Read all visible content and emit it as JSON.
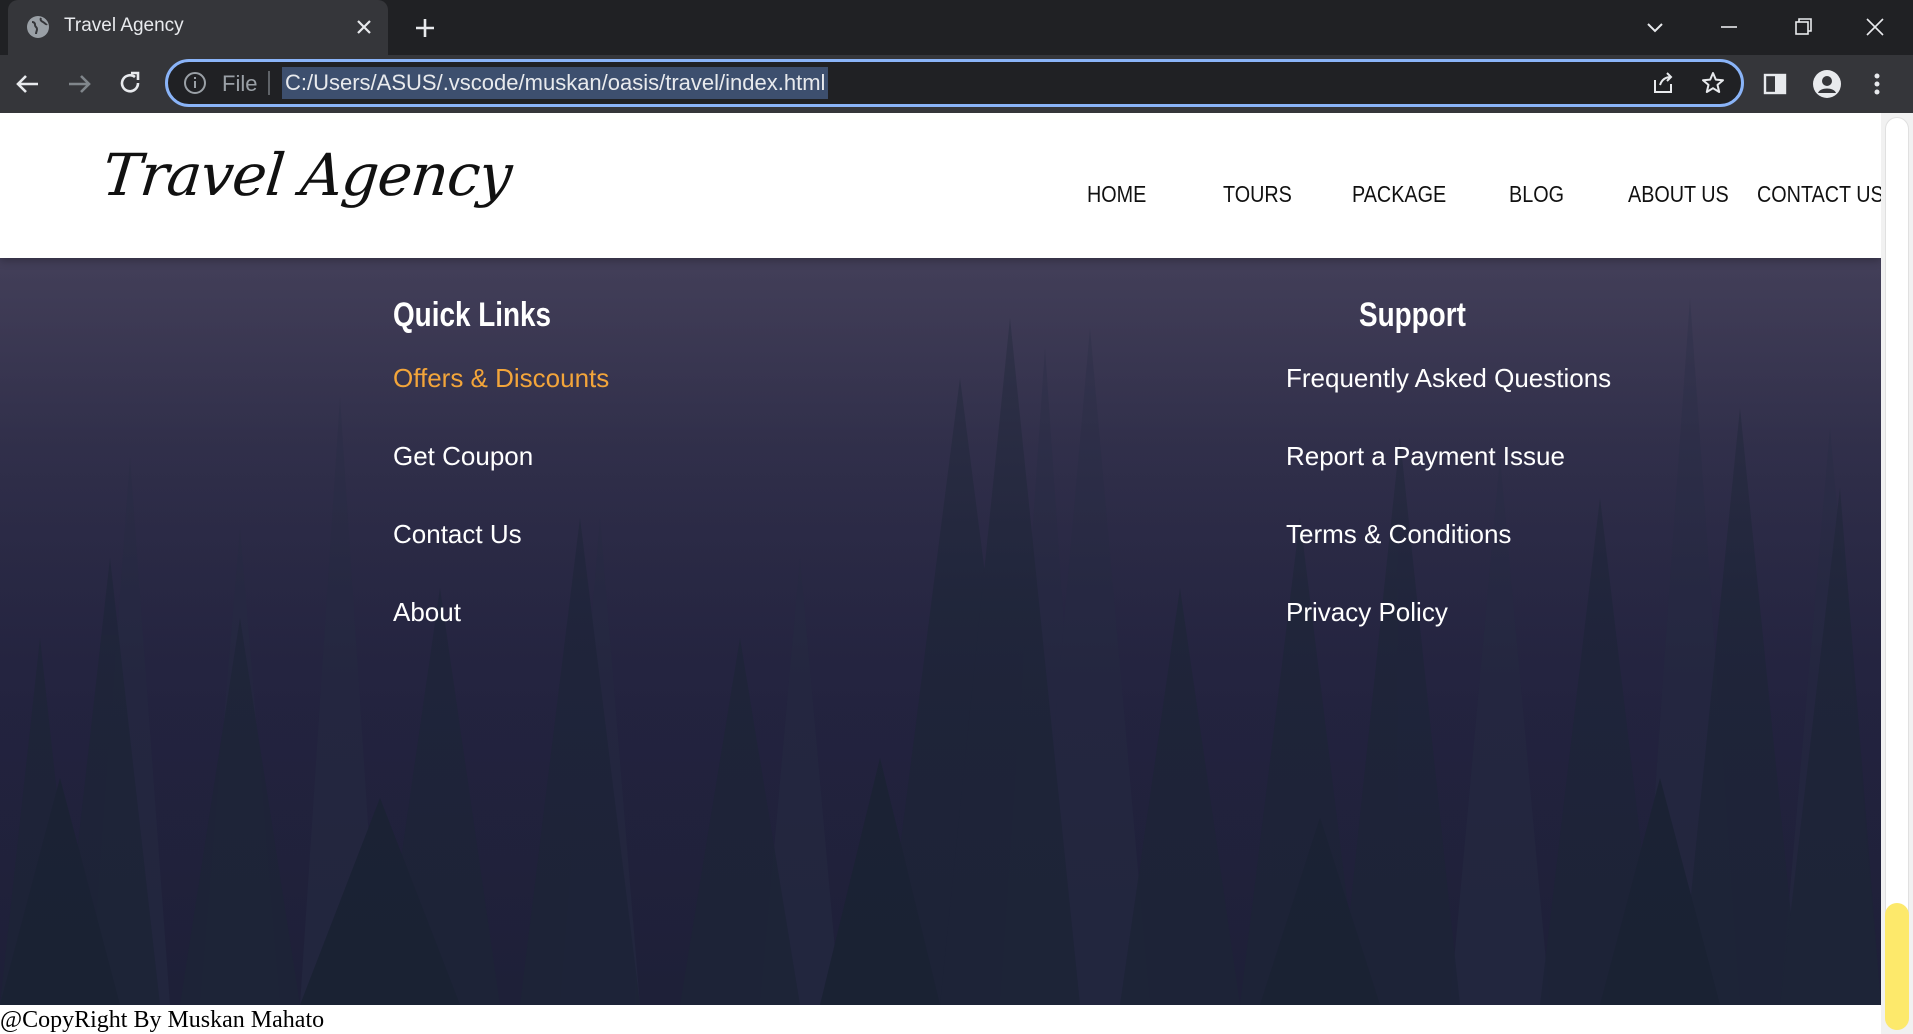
{
  "browser": {
    "tab_title": "Travel Agency",
    "omnibox": {
      "scheme_label": "File",
      "url": "C:/Users/ASUS/.vscode/muskan/oasis/travel/index.html"
    },
    "icons": [
      "globe-icon",
      "close-icon",
      "plus-icon",
      "chevron-down-icon",
      "minimize-icon",
      "restore-icon",
      "close-window-icon",
      "back-icon",
      "forward-icon",
      "reload-icon",
      "info-icon",
      "share-icon",
      "star-icon",
      "sidebar-icon",
      "profile-icon",
      "menu-icon"
    ]
  },
  "site": {
    "logo": "Travel Agency",
    "nav": [
      "HOME",
      "TOURS",
      "PACKAGE",
      "BLOG",
      "ABOUT US",
      "CONTACT US"
    ]
  },
  "footer": {
    "quick_links": {
      "title": "Quick Links",
      "items": [
        "Offers & Discounts",
        "Get Coupon",
        "Contact Us",
        "About"
      ],
      "active_color": "#f3a53a"
    },
    "support": {
      "title": "Support",
      "items": [
        "Frequently Asked Questions",
        "Report a Payment Issue",
        "Terms & Conditions",
        "Privacy Policy"
      ]
    },
    "copyright": "@CopyRight By Muskan Mahato"
  },
  "colors": {
    "chrome_dark": "#202124",
    "chrome_tab": "#35363a",
    "omnibox_focus": "#8ab4f8",
    "scroll_thumb": "#fde96b"
  }
}
